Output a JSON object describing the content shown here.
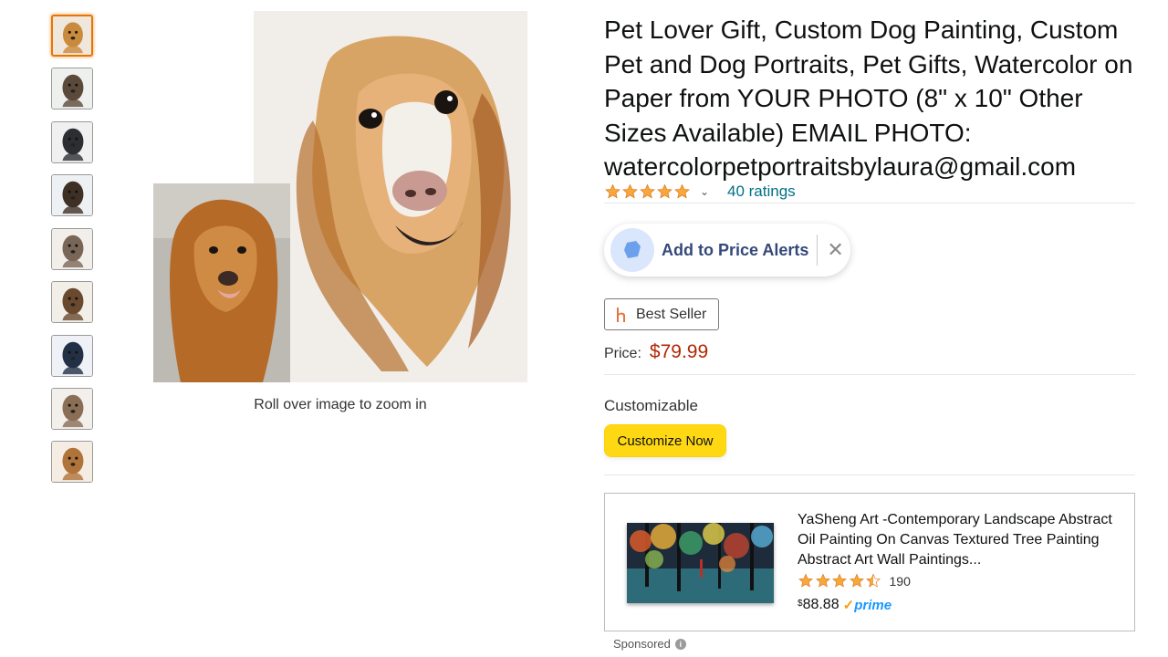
{
  "gallery": {
    "thumbnails": [
      {
        "label": "golden-retriever-portrait",
        "bg": "#efe6dc",
        "subject": "#c98a3c"
      },
      {
        "label": "german-shepherd-portrait",
        "bg": "#eef0ee",
        "subject": "#5b4a3a"
      },
      {
        "label": "black-dog-portrait",
        "bg": "#f0f0f0",
        "subject": "#2b2e33"
      },
      {
        "label": "horse-portrait",
        "bg": "#eef1f4",
        "subject": "#3f3026"
      },
      {
        "label": "terrier-portrait",
        "bg": "#f2efea",
        "subject": "#7a6657"
      },
      {
        "label": "spaniel-portrait",
        "bg": "#f2efe9",
        "subject": "#6a4a2e"
      },
      {
        "label": "greyhound-portrait",
        "bg": "#eef1f5",
        "subject": "#223046"
      },
      {
        "label": "collie-portrait",
        "bg": "#f3efea",
        "subject": "#8a6e55"
      },
      {
        "label": "puppy-portrait",
        "bg": "#f5ece4",
        "subject": "#b0743a"
      }
    ],
    "zoom_hint": "Roll over image to zoom in"
  },
  "product": {
    "title": "Pet Lover Gift, Custom Dog Painting, Custom Pet and Dog Portraits, Pet Gifts, Watercolor on Paper from YOUR PHOTO (8\" x 10\" Other Sizes Available) EMAIL PHOTO: watercolorpetportraitsbylaura@gmail.com",
    "rating": 5,
    "ratings_text": "40 ratings",
    "price_label": "Price:",
    "price": "$79.99",
    "customizable_label": "Customizable",
    "customize_button": "Customize Now"
  },
  "price_alert": {
    "label": "Add to Price Alerts",
    "close_glyph": "✕"
  },
  "badge": {
    "label": "Best Seller",
    "icon": "honey-h-icon"
  },
  "sponsored_ad": {
    "title": "YaSheng Art -Contemporary Landscape Abstract Oil Painting On Canvas Textured Tree Painting Abstract Art Wall Paintings...",
    "rating": 4.5,
    "rating_count": "190",
    "currency": "$",
    "price": "88.88",
    "prime_label": "prime",
    "sponsored_label": "Sponsored"
  },
  "colors": {
    "star": "#f7a83a",
    "link": "#007185",
    "price": "#b12704",
    "button": "#ffd814",
    "active_thumb": "#e77600",
    "alert_text": "#34497a"
  }
}
